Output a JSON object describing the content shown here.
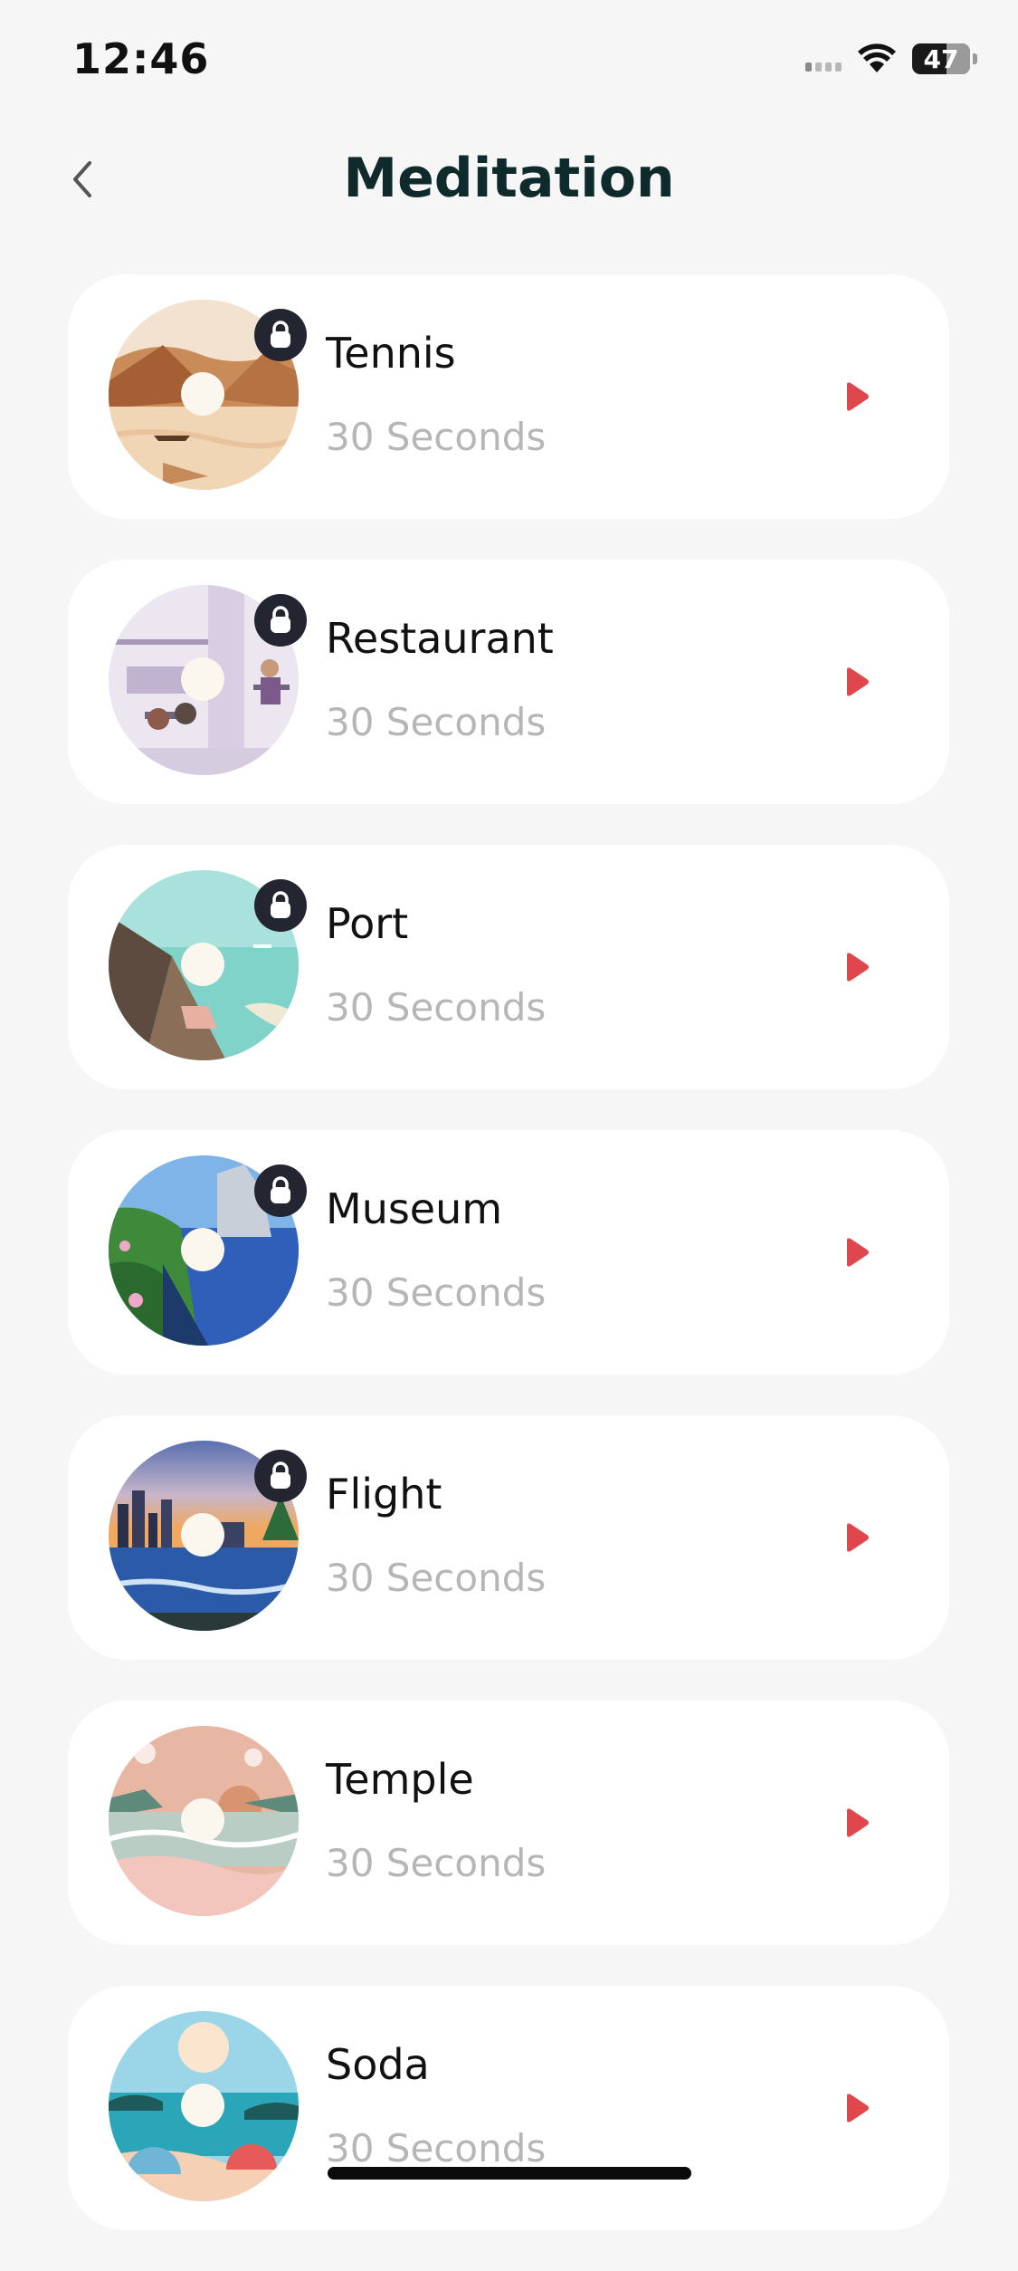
{
  "status_bar": {
    "time": "12:46",
    "battery": "47",
    "battery_level": 0.47
  },
  "header": {
    "title": "Meditation",
    "back_icon": "chevron-left-icon"
  },
  "items": [
    {
      "title": "Tennis",
      "duration": "30 Seconds",
      "locked": true,
      "theme": "desert"
    },
    {
      "title": "Restaurant",
      "duration": "30 Seconds",
      "locked": true,
      "theme": "cafe"
    },
    {
      "title": "Port",
      "duration": "30 Seconds",
      "locked": true,
      "theme": "pier"
    },
    {
      "title": "Museum",
      "duration": "30 Seconds",
      "locked": true,
      "theme": "cliff"
    },
    {
      "title": "Flight",
      "duration": "30 Seconds",
      "locked": true,
      "theme": "city"
    },
    {
      "title": "Temple",
      "duration": "30 Seconds",
      "locked": false,
      "theme": "sunset-beach"
    },
    {
      "title": "Soda",
      "duration": "30 Seconds",
      "locked": false,
      "theme": "tropical"
    }
  ],
  "colors": {
    "background": "#f6f6f6",
    "card": "#ffffff",
    "title": "#0f2a2a",
    "play": "#e0474c",
    "duration": "#b6b6b6",
    "lock_badge": "#232530"
  }
}
